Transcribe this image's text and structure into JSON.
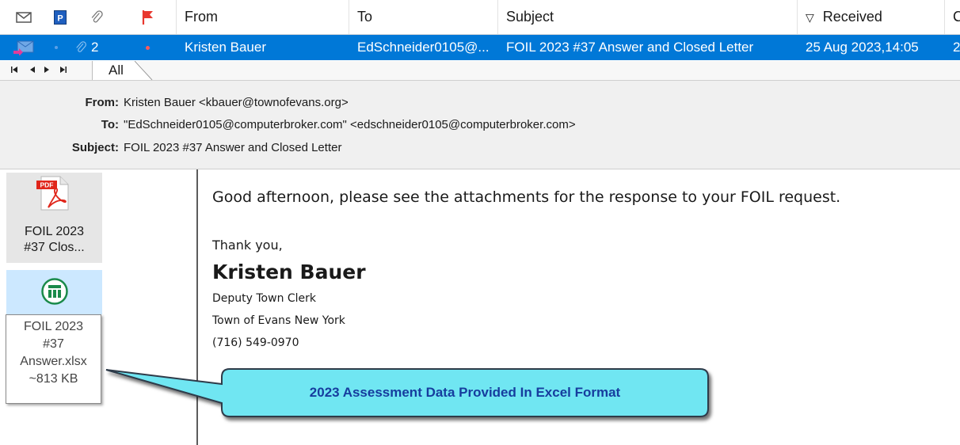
{
  "column_header": {
    "icons": [
      "envelope-icon",
      "pgp-icon",
      "paperclip-icon",
      "flag-icon"
    ],
    "from": "From",
    "to": "To",
    "subject": "Subject",
    "received": "Received",
    "received_sort_glyph": "▽",
    "extra": "C"
  },
  "selected_message": {
    "attachment_count": "2",
    "from": "Kristen Bauer",
    "to": "EdSchneider0105@...",
    "subject": "FOIL 2023 #37 Answer and Closed Letter",
    "received": "25 Aug 2023,14:05",
    "extra": "2"
  },
  "nav": {
    "first_glyph": "◂",
    "tab_all": "All"
  },
  "header": {
    "from_label": "From:",
    "from_value": "Kristen Bauer <kbauer@townofevans.org>",
    "to_label": "To:",
    "to_value": "\"EdSchneider0105@computerbroker.com\" <edschneider0105@computerbroker.com>",
    "subject_label": "Subject:",
    "subject_value": "FOIL 2023 #37 Answer and Closed Letter"
  },
  "attachments": [
    {
      "icon_text": "PDF",
      "line1": "FOIL 2023",
      "line2": "#37 Clos..."
    },
    {
      "line1": "FOIL 2023",
      "line2": "#37",
      "line3": "Answer.xlsx",
      "line4": "~813 KB"
    }
  ],
  "body": {
    "greeting": "Good afternoon, please see the attachments for the response to your FOIL request.",
    "thanks": "Thank you,",
    "signature_name": "Kristen Bauer",
    "signature_title": "Deputy Town Clerk",
    "signature_org": "Town of Evans New York",
    "signature_phone": "(716) 549-0970"
  },
  "callout": {
    "text": "2023 Assessment Data Provided In Excel Format"
  },
  "colors": {
    "selection": "#0078d7",
    "callout_fill": "#6fe6f2",
    "callout_text": "#163d9e",
    "flag": "#e8382f",
    "excel_green": "#1a8a4a",
    "pdf_red": "#e0261b"
  }
}
